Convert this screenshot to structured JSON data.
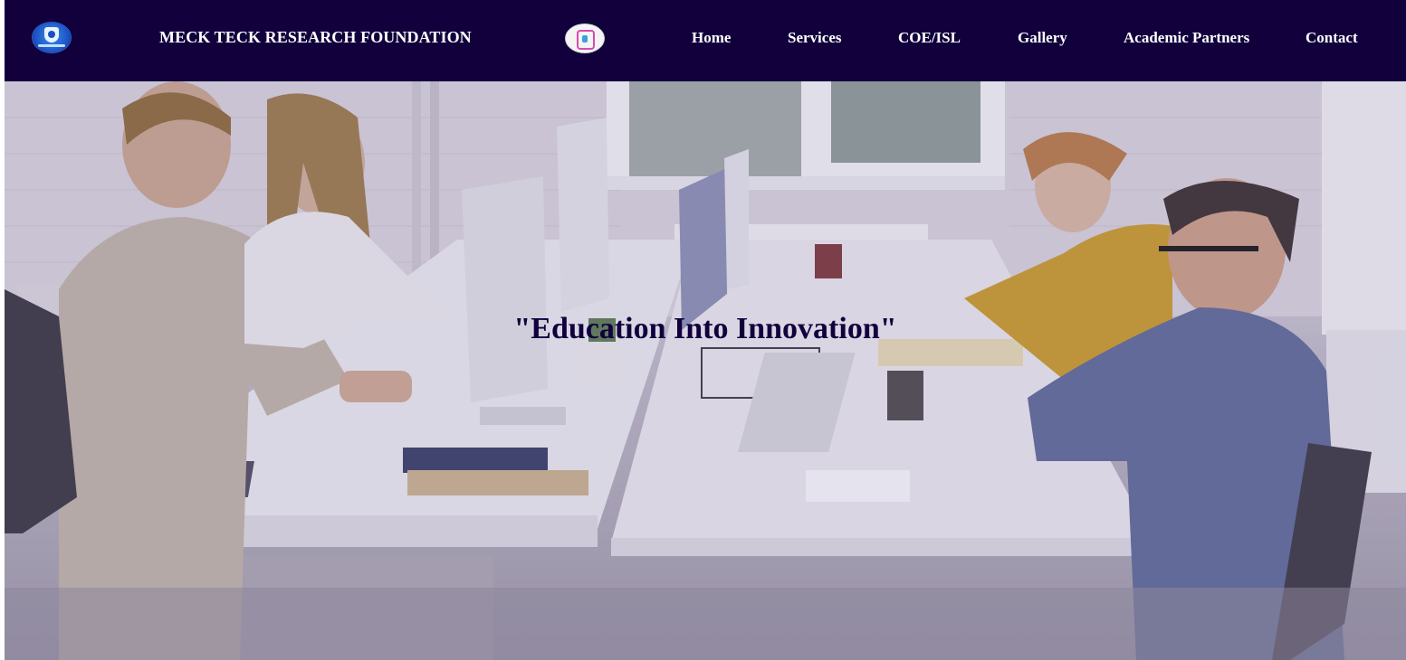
{
  "header": {
    "brand_name": "MECK TECK RESEARCH FOUNDATION",
    "logo_left_icon": "shield-logo-icon",
    "logo_center_icon": "foundation-emblem-icon",
    "background_color": "#12003d",
    "text_color": "#ffffff"
  },
  "nav": {
    "items": [
      {
        "label": "Home"
      },
      {
        "label": "Services"
      },
      {
        "label": "COE/ISL"
      },
      {
        "label": "Gallery"
      },
      {
        "label": "Academic Partners"
      },
      {
        "label": "Contact"
      }
    ]
  },
  "hero": {
    "quote": "\"Education Into Innovation\"",
    "quote_color": "#12003d",
    "image_subject": "office-workers-at-desks"
  }
}
